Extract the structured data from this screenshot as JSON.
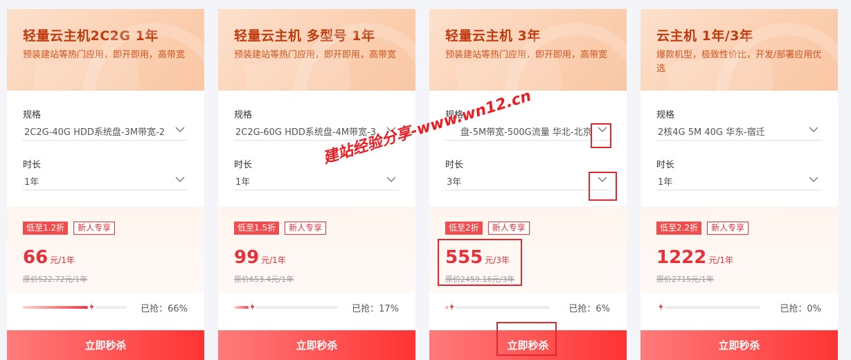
{
  "cards": [
    {
      "title": "轻量云主机2C2G 1年",
      "desc": "预装建站等热门应用，即开即用，高带宽",
      "spec_label": "规格",
      "spec_value": "2C2G-40G HDD系统盘-3M带宽-2",
      "duration_label": "时长",
      "duration_value": "1年",
      "discount_tag": "低至1.2折",
      "new_tag": "新人专享",
      "price": "66",
      "price_unit": "元/1年",
      "original_price": "原价522.72元/1年",
      "progress_percent": 66,
      "sold_text": "已抢：66%",
      "buy_label": "立即秒杀"
    },
    {
      "title": "轻量云主机 多型号 1年",
      "desc": "预装建站等热门应用，即开即用，高带宽",
      "spec_label": "规格",
      "spec_value": "2C2G-60G HDD系统盘-4M带宽-3",
      "duration_label": "时长",
      "duration_value": "1年",
      "discount_tag": "低至1.5折",
      "new_tag": "新人专享",
      "price": "99",
      "price_unit": "元/1年",
      "original_price": "原价653.4元/1年",
      "progress_percent": 17,
      "sold_text": "已抢：17%",
      "buy_label": "立即秒杀"
    },
    {
      "title": "轻量云主机 3年",
      "desc": "预装建站等热门应用，即开即用，高带宽",
      "spec_label": "规格",
      "spec_value": "盘-5M带宽-500G流量 华北-北京",
      "duration_label": "时长",
      "duration_value": "3年",
      "discount_tag": "低至2折",
      "new_tag": "新人专享",
      "price": "555",
      "price_unit": "元/3年",
      "original_price": "原价2459.16元/3年",
      "progress_percent": 6,
      "sold_text": "已抢：6%",
      "buy_label": "立即秒杀"
    },
    {
      "title": "云主机 1年/3年",
      "desc": "爆款机型，极致性价比，开发/部署应用优选",
      "spec_label": "规格",
      "spec_value": "2核4G 5M 40G 华东-宿迁",
      "duration_label": "时长",
      "duration_value": "1年",
      "discount_tag": "低至2.2折",
      "new_tag": "新人专享",
      "price": "1222",
      "price_unit": "元/1年",
      "original_price": "原价2715元/1年",
      "progress_percent": 0,
      "sold_text": "已抢：0%",
      "buy_label": "立即秒杀"
    }
  ],
  "watermark": "建站经验分享-www.wn12.cn",
  "colors": {
    "accent_red": "#e6313a",
    "title_orange": "#c03c10",
    "highlight_box": "#e2262b"
  }
}
